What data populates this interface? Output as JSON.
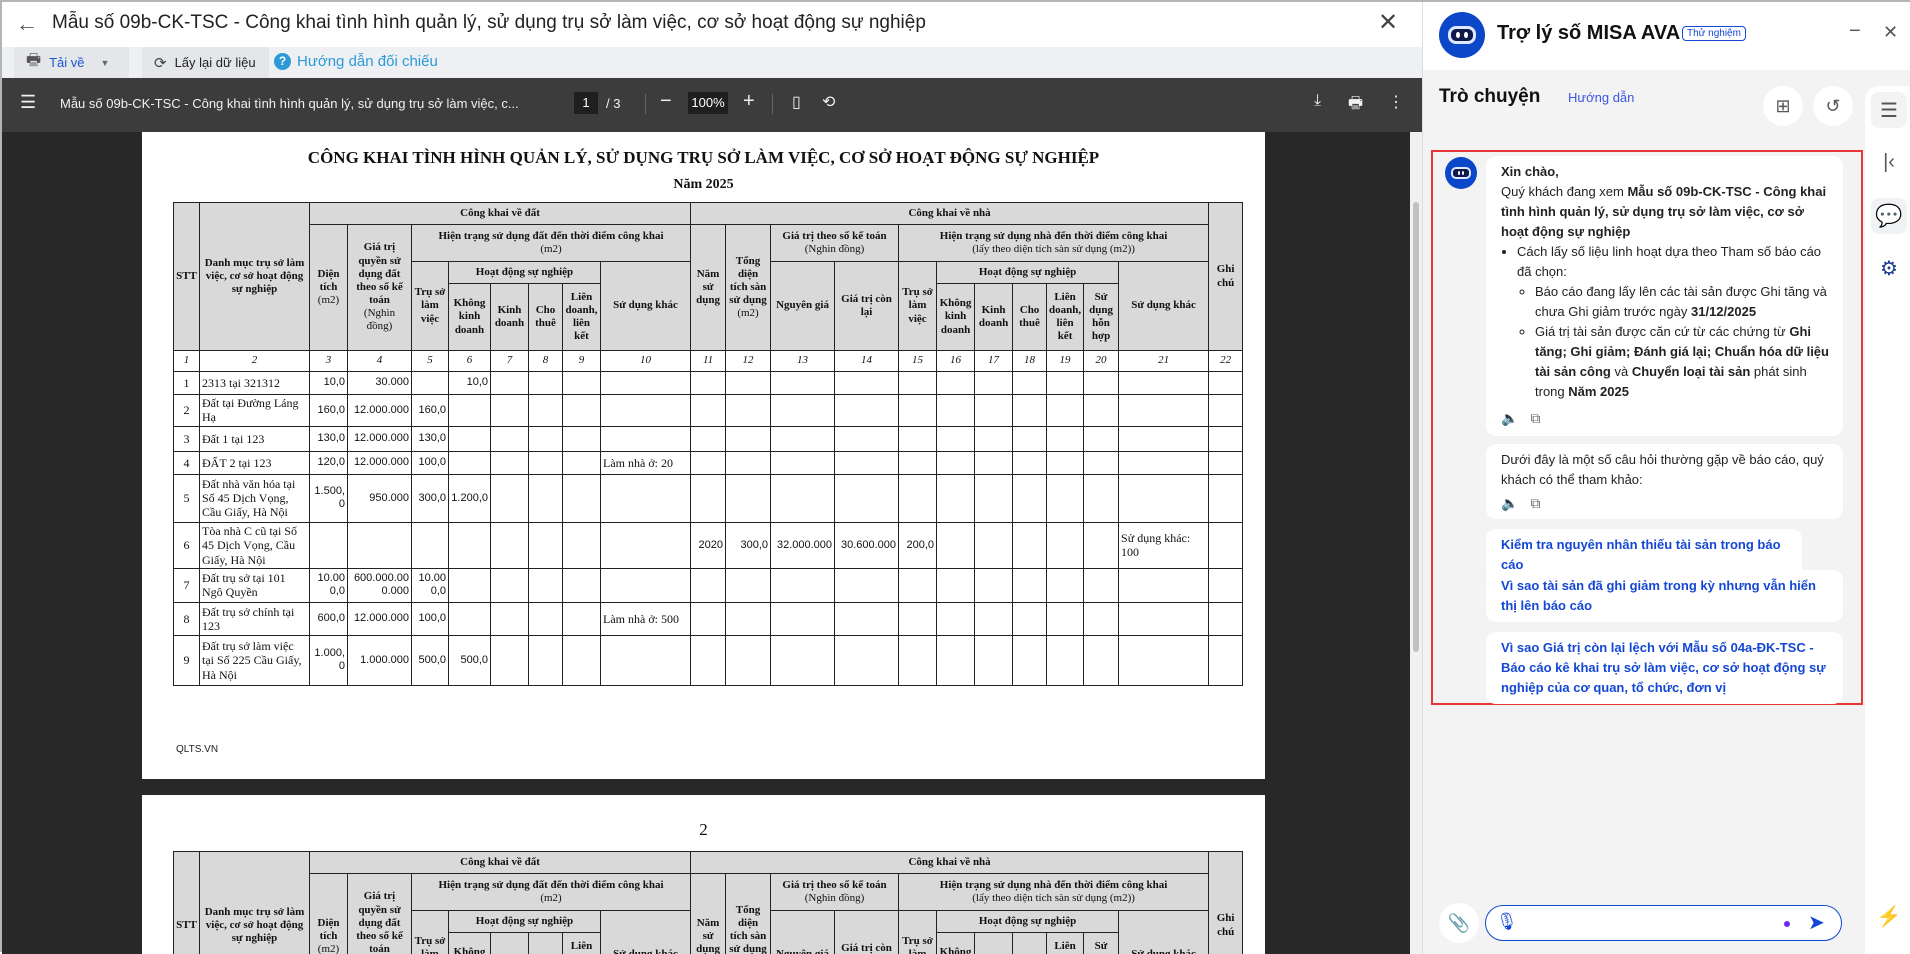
{
  "window": {
    "title": "Mẫu số 09b-CK-TSC - Công khai tình hình quản lý, sử dụng trụ sở làm việc, cơ sở hoạt động sự nghiệp"
  },
  "toolbar": {
    "download": "Tải về",
    "reload": "Lấy lại dữ liệu",
    "guide": "Hướng dẫn đối chiếu"
  },
  "pdf": {
    "title": "Mẫu số 09b-CK-TSC - Công khai tình hình quản lý, sử dụng trụ sở làm việc, c...",
    "page": "1",
    "total": "/ 3",
    "zoom": "100%"
  },
  "report": {
    "title": "CÔNG KHAI TÌNH HÌNH QUẢN LÝ, SỬ DỤNG TRỤ SỞ LÀM VIỆC, CƠ SỞ HOẠT ĐỘNG SỰ NGHIỆP",
    "year": "Năm 2025",
    "footer": "QLTS.VN",
    "page2_number": "2",
    "header": {
      "stt": "STT",
      "name": "Danh mục trụ sở làm việc, cơ sở hoạt động sự nghiệp",
      "land": "Công khai về đất",
      "house": "Công khai về nhà",
      "note": "Ghi chú",
      "area": "Diện tích",
      "area_unit": "(m2)",
      "land_value": "Giá trị quyền sử dụng đất theo sổ kế toán",
      "land_value_unit": "(Nghìn đồng)",
      "land_status": "Hiện trạng sử dụng đất đến thời điểm công khai",
      "land_status_unit": "(m2)",
      "year_use": "Năm sử dụng",
      "floor_area": "Tổng diện tích sàn sử dụng",
      "floor_unit": "(m2)",
      "book_value": "Giá trị theo sổ kế toán",
      "book_value_unit": "(Nghìn đồng)",
      "house_status": "Hiện trạng sử dụng nhà đến thời điểm công khai",
      "house_status_unit": "(lấy theo diện tích sàn sử dụng (m2))",
      "office": "Trụ sở làm việc",
      "career": "Hoạt động sự nghiệp",
      "other": "Sử dụng khác",
      "orig": "Nguyên giá",
      "remain": "Giá trị còn lại",
      "nonbiz": "Không kinh doanh",
      "biz": "Kinh doanh",
      "rent": "Cho thuê",
      "joint": "Liên doanh, liên kết",
      "mixed": "Sử dụng hỗn hợp"
    },
    "col_numbers": [
      "1",
      "2",
      "3",
      "4",
      "5",
      "6",
      "7",
      "8",
      "9",
      "10",
      "11",
      "12",
      "13",
      "14",
      "15",
      "16",
      "17",
      "18",
      "19",
      "20",
      "21",
      "22"
    ],
    "rows": [
      [
        "1",
        "2313 tại 321312",
        "10,0",
        "30.000",
        "",
        "10,0",
        "",
        "",
        "",
        "",
        "",
        "",
        "",
        "",
        "",
        "",
        "",
        "",
        "",
        "",
        "",
        ""
      ],
      [
        "2",
        "Đất tại Đường Láng Hạ",
        "160,0",
        "12.000.000",
        "160,0",
        "",
        "",
        "",
        "",
        "",
        "",
        "",
        "",
        "",
        "",
        "",
        "",
        "",
        "",
        "",
        "",
        ""
      ],
      [
        "3",
        "Đất 1  tại 123",
        "130,0",
        "12.000.000",
        "130,0",
        "",
        "",
        "",
        "",
        "",
        "",
        "",
        "",
        "",
        "",
        "",
        "",
        "",
        "",
        "",
        "",
        ""
      ],
      [
        "4",
        "ĐẤT 2 tại 123",
        "120,0",
        "12.000.000",
        "100,0",
        "",
        "",
        "",
        "",
        "Làm nhà ở: 20",
        "",
        "",
        "",
        "",
        "",
        "",
        "",
        "",
        "",
        "",
        "",
        ""
      ],
      [
        "5",
        "Đất nhà văn hóa tại Số 45 Dịch Vọng, Cầu Giấy, Hà Nội",
        "1.500,0",
        "950.000",
        "300,0",
        "1.200,0",
        "",
        "",
        "",
        "",
        "",
        "",
        "",
        "",
        "",
        "",
        "",
        "",
        "",
        "",
        "",
        ""
      ],
      [
        "6",
        "Tòa nhà C cũ tại Số 45 Dịch Vọng, Cầu Giấy, Hà Nội",
        "",
        "",
        "",
        "",
        "",
        "",
        "",
        "",
        "2020",
        "300,0",
        "32.000.000",
        "30.600.000",
        "200,0",
        "",
        "",
        "",
        "",
        "",
        "Sử dụng khác: 100",
        ""
      ],
      [
        "7",
        "Đất trụ sở tại 101 Ngô Quyền",
        "10.000,0",
        "600.000.000.000",
        "10.000,0",
        "",
        "",
        "",
        "",
        "",
        "",
        "",
        "",
        "",
        "",
        "",
        "",
        "",
        "",
        "",
        "",
        ""
      ],
      [
        "8",
        "Đất trụ sở chính tại 123",
        "600,0",
        "12.000.000",
        "100,0",
        "",
        "",
        "",
        "",
        "Làm nhà ở: 500",
        "",
        "",
        "",
        "",
        "",
        "",
        "",
        "",
        "",
        "",
        "",
        ""
      ],
      [
        "9",
        "Đất trụ sở làm việc tại Số 225 Cầu Giấy, Hà Nội",
        "1.000,0",
        "1.000.000",
        "500,0",
        "500,0",
        "",
        "",
        "",
        "",
        "",
        "",
        "",
        "",
        "",
        "",
        "",
        "",
        "",
        "",
        "",
        ""
      ]
    ]
  },
  "assistant": {
    "title": "Trợ lý số MISA AVA",
    "badge": "Thử nghiệm",
    "tab": "Trò chuyện",
    "guide": "Hướng dẫn",
    "msg1": {
      "greeting": "Xin chào,",
      "intro": "Quý khách đang xem ",
      "report": "Mẫu số 09b-CK-TSC - Công khai tình hình quản lý, sử dụng trụ sở làm việc, cơ sở hoạt động sự nghiệp",
      "b1": "Cách lấy số liệu linh hoạt dựa theo Tham số báo cáo đã chọn:",
      "b1a": "Báo cáo đang lấy lên các tài sản được Ghi tăng và chưa Ghi giảm trước ngày ",
      "b1a_date": "31/12/2025",
      "b1b": "Giá trị tài sản được căn cứ từ các chứng từ ",
      "b1b_docs": "Ghi tăng; Ghi giảm; Đánh giá lại; Chuẩn hóa dữ liệu tài sản công",
      "b1b_and": " và ",
      "b1b_move": "Chuyển loại tài sản",
      "b1b_rest": " phát sinh trong ",
      "b1b_year": "Năm 2025"
    },
    "msg2": "Dưới đây là một số câu hỏi thường gặp về báo cáo, quý khách có thể tham khảo:",
    "suggestions": [
      "Kiểm tra nguyên nhân thiếu tài sản trong báo cáo",
      "Vì sao tài sản đã ghi giảm trong kỳ nhưng vẫn hiển thị lên báo cáo",
      "Vì sao Giá trị còn lại lệch với Mẫu số 04a-ĐK-TSC - Báo cáo kê khai trụ sở làm việc, cơ sở hoạt động sự nghiệp của cơ quan, tổ chức, đơn vị"
    ],
    "input_value": ""
  },
  "colors": {
    "accent": "#1447d6",
    "help": "#2c9ad6",
    "highlight": "#e8363c"
  }
}
